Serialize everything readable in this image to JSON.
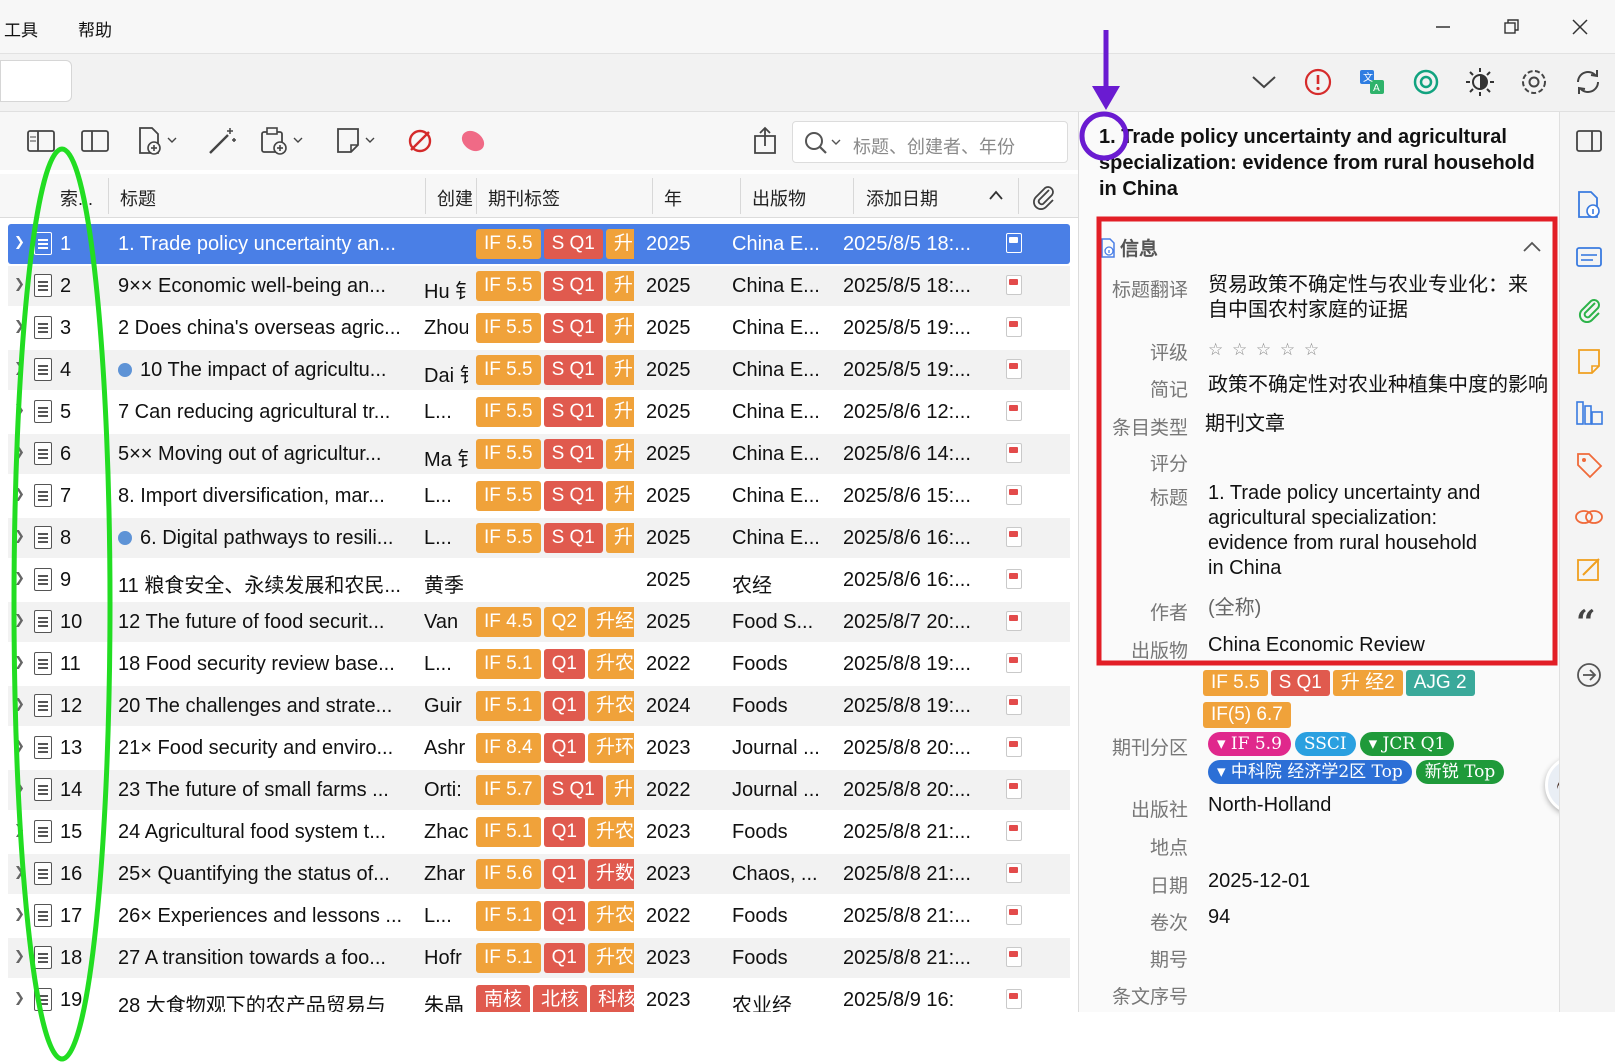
{
  "menu": {
    "tools": "工具",
    "help": "帮助"
  },
  "items_pane": {
    "search_placeholder": "标题、创建者、年份",
    "columns": {
      "index": "索...",
      "title": "标题",
      "creator": "创建",
      "journal_tags": "期刊标签",
      "year": "年",
      "publication": "出版物",
      "date_added": "添加日期"
    }
  },
  "rows": [
    {
      "idx": "1",
      "title": "1. Trade policy uncertainty an...",
      "creator": "",
      "year": "2025",
      "pub": "China E...",
      "added": "2025/8/5 18:...",
      "dot": false,
      "tags": [
        [
          "IF 5.5",
          "#f0a23a"
        ],
        [
          "S Q1",
          "#e05a4e"
        ],
        [
          "升",
          "#f0a23a"
        ]
      ]
    },
    {
      "idx": "2",
      "title": "9×× Economic well-being an...",
      "creator": "Hu 钅",
      "year": "2025",
      "pub": "China E...",
      "added": "2025/8/5 18:...",
      "dot": false,
      "tags": [
        [
          "IF 5.5",
          "#f0a23a"
        ],
        [
          "S Q1",
          "#e05a4e"
        ],
        [
          "升",
          "#f0a23a"
        ]
      ]
    },
    {
      "idx": "3",
      "title": "2 Does china's overseas agric...",
      "creator": "Zhou",
      "year": "2025",
      "pub": "China E...",
      "added": "2025/8/5 19:...",
      "dot": false,
      "tags": [
        [
          "IF 5.5",
          "#f0a23a"
        ],
        [
          "S Q1",
          "#e05a4e"
        ],
        [
          "升",
          "#f0a23a"
        ]
      ]
    },
    {
      "idx": "4",
      "title": "10 The impact of agricultu...",
      "creator": "Dai 钅",
      "year": "2025",
      "pub": "China E...",
      "added": "2025/8/5 19:...",
      "dot": true,
      "tags": [
        [
          "IF 5.5",
          "#f0a23a"
        ],
        [
          "S Q1",
          "#e05a4e"
        ],
        [
          "升",
          "#f0a23a"
        ]
      ]
    },
    {
      "idx": "5",
      "title": "7 Can reducing agricultural tr...",
      "creator": "L...",
      "year": "2025",
      "pub": "China E...",
      "added": "2025/8/6 12:...",
      "dot": false,
      "tags": [
        [
          "IF 5.5",
          "#f0a23a"
        ],
        [
          "S Q1",
          "#e05a4e"
        ],
        [
          "升",
          "#f0a23a"
        ]
      ]
    },
    {
      "idx": "6",
      "title": "5×× Moving out of agricultur...",
      "creator": "Ma 钅",
      "year": "2025",
      "pub": "China E...",
      "added": "2025/8/6 14:...",
      "dot": false,
      "tags": [
        [
          "IF 5.5",
          "#f0a23a"
        ],
        [
          "S Q1",
          "#e05a4e"
        ],
        [
          "升",
          "#f0a23a"
        ]
      ]
    },
    {
      "idx": "7",
      "title": "8. Import diversification, mar...",
      "creator": "L...",
      "year": "2025",
      "pub": "China E...",
      "added": "2025/8/6 15:...",
      "dot": false,
      "tags": [
        [
          "IF 5.5",
          "#f0a23a"
        ],
        [
          "S Q1",
          "#e05a4e"
        ],
        [
          "升",
          "#f0a23a"
        ]
      ]
    },
    {
      "idx": "8",
      "title": "6. Digital pathways to resili...",
      "creator": "L...",
      "year": "2025",
      "pub": "China E...",
      "added": "2025/8/6 16:...",
      "dot": true,
      "tags": [
        [
          "IF 5.5",
          "#f0a23a"
        ],
        [
          "S Q1",
          "#e05a4e"
        ],
        [
          "升",
          "#f0a23a"
        ]
      ]
    },
    {
      "idx": "9",
      "title": "11 粮食安全、永续发展和农民...",
      "creator": "黄季",
      "year": "2025",
      "pub": "农经",
      "added": "2025/8/6 16:...",
      "dot": false,
      "tags": []
    },
    {
      "idx": "10",
      "title": "12 The future of food securit...",
      "creator": "Van",
      "year": "2025",
      "pub": "Food S...",
      "added": "2025/8/7 20:...",
      "dot": false,
      "tags": [
        [
          "IF 4.5",
          "#f0a23a"
        ],
        [
          "Q2",
          "#f0a23a"
        ],
        [
          "升经",
          "#f0a23a"
        ]
      ]
    },
    {
      "idx": "11",
      "title": "18 Food security review base...",
      "creator": "L...",
      "year": "2022",
      "pub": "Foods",
      "added": "2025/8/8 19:...",
      "dot": false,
      "tags": [
        [
          "IF 5.1",
          "#f0a23a"
        ],
        [
          "Q1",
          "#e05a4e"
        ],
        [
          "升农",
          "#f0a23a"
        ]
      ]
    },
    {
      "idx": "12",
      "title": "20 The challenges and strate...",
      "creator": "Guir",
      "year": "2024",
      "pub": "Foods",
      "added": "2025/8/8 19:...",
      "dot": false,
      "tags": [
        [
          "IF 5.1",
          "#f0a23a"
        ],
        [
          "Q1",
          "#e05a4e"
        ],
        [
          "升农",
          "#f0a23a"
        ]
      ]
    },
    {
      "idx": "13",
      "title": "21× Food security and enviro...",
      "creator": "Ashr",
      "year": "2023",
      "pub": "Journal ...",
      "added": "2025/8/8 20:...",
      "dot": false,
      "tags": [
        [
          "IF 8.4",
          "#f0a23a"
        ],
        [
          "Q1",
          "#e05a4e"
        ],
        [
          "升环",
          "#f0a23a"
        ]
      ]
    },
    {
      "idx": "14",
      "title": "23 The future of small farms ...",
      "creator": "Orti:",
      "year": "2022",
      "pub": "Journal ...",
      "added": "2025/8/8 20:...",
      "dot": false,
      "tags": [
        [
          "IF 5.7",
          "#f0a23a"
        ],
        [
          "S Q1",
          "#e05a4e"
        ],
        [
          "升",
          "#f0a23a"
        ]
      ]
    },
    {
      "idx": "15",
      "title": "24 Agricultural food system t...",
      "creator": "Zhac",
      "year": "2023",
      "pub": "Foods",
      "added": "2025/8/8 21:...",
      "dot": false,
      "tags": [
        [
          "IF 5.1",
          "#f0a23a"
        ],
        [
          "Q1",
          "#e05a4e"
        ],
        [
          "升农",
          "#f0a23a"
        ]
      ]
    },
    {
      "idx": "16",
      "title": "25× Quantifying the status of...",
      "creator": "Zhar",
      "year": "2023",
      "pub": "Chaos, ...",
      "added": "2025/8/8 21:...",
      "dot": false,
      "tags": [
        [
          "IF 5.6",
          "#f0a23a"
        ],
        [
          "Q1",
          "#e05a4e"
        ],
        [
          "升数",
          "#e05a4e"
        ]
      ]
    },
    {
      "idx": "17",
      "title": "26× Experiences and lessons ...",
      "creator": "L...",
      "year": "2022",
      "pub": "Foods",
      "added": "2025/8/8 21:...",
      "dot": false,
      "tags": [
        [
          "IF 5.1",
          "#f0a23a"
        ],
        [
          "Q1",
          "#e05a4e"
        ],
        [
          "升农",
          "#f0a23a"
        ]
      ]
    },
    {
      "idx": "18",
      "title": "27 A transition towards a foo...",
      "creator": "Hofr",
      "year": "2023",
      "pub": "Foods",
      "added": "2025/8/8 21:...",
      "dot": false,
      "tags": [
        [
          "IF 5.1",
          "#f0a23a"
        ],
        [
          "Q1",
          "#e05a4e"
        ],
        [
          "升农",
          "#f0a23a"
        ]
      ]
    },
    {
      "idx": "19",
      "title": "28 大食物观下的农产品贸易与",
      "creator": "朱晶",
      "year": "2023",
      "pub": "农业经",
      "added": "2025/8/9 16:",
      "dot": false,
      "tags": [
        [
          "南核",
          "#e05a4e"
        ],
        [
          "北核",
          "#e05a4e"
        ],
        [
          "科核",
          "#e05a4e"
        ]
      ]
    }
  ],
  "detail": {
    "title": "1. Trade policy uncertainty and agricultural specialization: evidence from rural household in China",
    "section_info": "信息",
    "fields": {
      "title_translation_label": "标题翻译",
      "title_translation": "贸易政策不确定性与农业专业化：来自中国农村家庭的证据",
      "rating_label": "评级",
      "rating_stars": "☆ ☆ ☆ ☆ ☆",
      "short_label": "简记",
      "short": "政策不确定性对农业种植集中度的影响",
      "item_type_label": "条目类型",
      "item_type": "期刊文章",
      "score_label": "评分",
      "title_label": "标题",
      "title_value": "1. Trade policy uncertainty and agricultural specialization: evidence from rural household in China",
      "author_label": "作者",
      "author_value": "(全称)",
      "publication_label": "出版物",
      "publication": "China Economic Review",
      "pub_tags": [
        [
          "IF 5.5",
          "#f0a23a"
        ],
        [
          "S Q1",
          "#e05a4e"
        ],
        [
          "升 经2",
          "#f0a23a"
        ],
        [
          "AJG 2",
          "#3aa99a"
        ],
        [
          "IF(5) 6.7",
          "#f0a23a"
        ]
      ],
      "journal_rank_label": "期刊分区",
      "rank_tags_1": [
        [
          "▾ IF 5.9",
          "#e0288c"
        ],
        [
          "SSCI",
          "#2aa0e0"
        ],
        [
          "▾ JCR Q1",
          "#1f9a3a"
        ]
      ],
      "rank_tags_2": [
        [
          "▾ 中科院 经济学2区 Top",
          "#2c6fd6"
        ],
        [
          "新锐 Top",
          "#1f9a3a"
        ]
      ],
      "publisher_label": "出版社",
      "publisher": "North-Holland",
      "place_label": "地点",
      "date_label": "日期",
      "date": "2025-12-01",
      "volume_label": "卷次",
      "volume": "94",
      "issue_label": "期号",
      "article_no_label": "条文序号"
    }
  },
  "colors": {
    "selection": "#4a7fe6",
    "tag_orange": "#f0a23a",
    "tag_red": "#e05a4e",
    "annotation_green": "#22dd22",
    "annotation_red": "#e21e26",
    "annotation_purple": "#6a1bd1"
  }
}
